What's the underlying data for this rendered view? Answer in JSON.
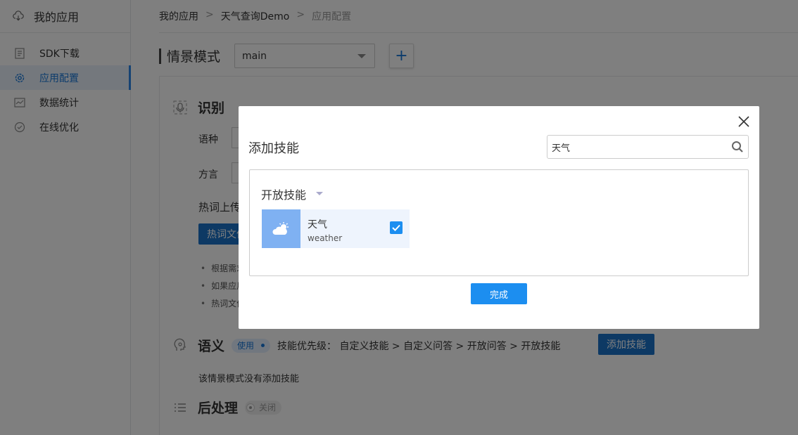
{
  "sidebar": {
    "app_title": "我的应用",
    "items": [
      {
        "label": "SDK下载",
        "icon": "document-icon"
      },
      {
        "label": "应用配置",
        "icon": "gear-icon",
        "active": true
      },
      {
        "label": "数据统计",
        "icon": "chart-icon"
      },
      {
        "label": "在线优化",
        "icon": "check-circle-icon"
      }
    ]
  },
  "breadcrumb": {
    "items": [
      "我的应用",
      "天气查询Demo",
      "应用配置"
    ],
    "separator": ">"
  },
  "scene": {
    "label": "情景模式",
    "selected": "main",
    "add_button": "+"
  },
  "recognition": {
    "title": "识别",
    "language_label": "语种",
    "dialect_label": "方言",
    "hotword_label": "热词上传",
    "hotword_button": "热词文件",
    "bullets": [
      "根据需求",
      "如果应用",
      "热词文件"
    ]
  },
  "semantic": {
    "title": "语义",
    "status": "使用",
    "priority_text": "技能优先级： 自定义技能 > 自定义问答 > 开放问答 > 开放技能",
    "add_skill_button": "添加技能",
    "empty_text": "该情景模式没有添加技能"
  },
  "postprocess": {
    "title": "后处理",
    "status": "关闭"
  },
  "modal": {
    "title": "添加技能",
    "search_value": "天气",
    "category": "开放技能",
    "skills": [
      {
        "name": "天气",
        "id": "weather",
        "checked": true
      }
    ],
    "done_button": "完成"
  },
  "colors": {
    "accent": "#1c8ef0",
    "dark_accent": "#1a73c8",
    "active_bg": "#e9f1fb",
    "card_bg": "#eef4fd",
    "skill_icon_bg": "#7fb1f2"
  }
}
